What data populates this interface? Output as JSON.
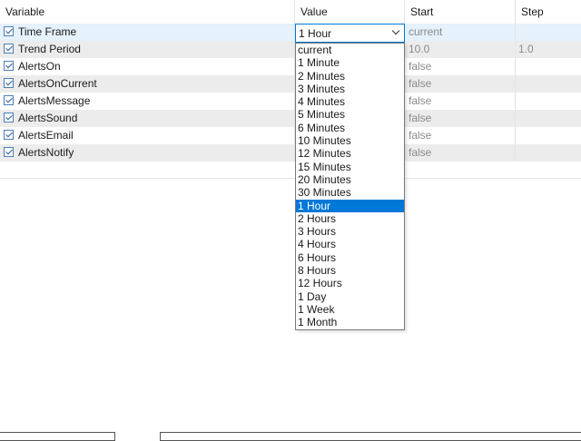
{
  "columns": [
    "Variable",
    "Value",
    "Start",
    "Step"
  ],
  "rows": [
    {
      "variable": "Time Frame",
      "value": "1 Hour",
      "start": "current",
      "step": ""
    },
    {
      "variable": "Trend Period",
      "value": "",
      "start": "10.0",
      "step": "1.0"
    },
    {
      "variable": "AlertsOn",
      "value": "",
      "start": "false",
      "step": ""
    },
    {
      "variable": "AlertsOnCurrent",
      "value": "",
      "start": "false",
      "step": ""
    },
    {
      "variable": "AlertsMessage",
      "value": "",
      "start": "false",
      "step": ""
    },
    {
      "variable": "AlertsSound",
      "value": "",
      "start": "false",
      "step": ""
    },
    {
      "variable": "AlertsEmail",
      "value": "",
      "start": "false",
      "step": ""
    },
    {
      "variable": "AlertsNotify",
      "value": "",
      "start": "false",
      "step": ""
    }
  ],
  "combo": {
    "selected": "1 Hour"
  },
  "dropdown": {
    "options": [
      "current",
      "1 Minute",
      "2 Minutes",
      "3 Minutes",
      "4 Minutes",
      "5 Minutes",
      "6 Minutes",
      "10 Minutes",
      "12 Minutes",
      "15 Minutes",
      "20 Minutes",
      "30 Minutes",
      "1 Hour",
      "2 Hours",
      "3 Hours",
      "4 Hours",
      "6 Hours",
      "8 Hours",
      "12 Hours",
      "1 Day",
      "1 Week",
      "1 Month"
    ],
    "selected_index": 12
  },
  "colors": {
    "accent": "#0078d7",
    "row_alt": "#ececec",
    "row_selected": "#e5f1fb"
  }
}
